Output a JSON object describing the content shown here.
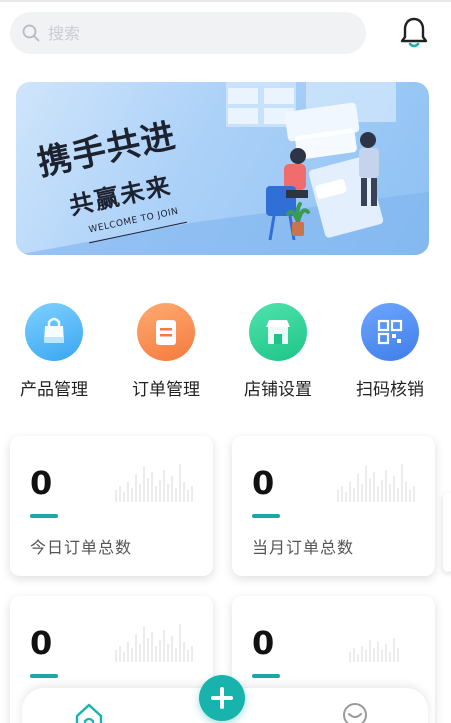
{
  "search": {
    "placeholder": "搜索",
    "icon": "search-icon"
  },
  "header": {
    "bell_icon": "bell-icon"
  },
  "banner": {
    "title": "携手共进",
    "subtitle": "共赢未来",
    "tagline": "WELCOME TO JOIN"
  },
  "menu": [
    {
      "label": "产品管理",
      "icon": "shopping-bag-icon",
      "color": "#5bb8f5"
    },
    {
      "label": "订单管理",
      "icon": "order-list-icon",
      "color": "#f58a4b"
    },
    {
      "label": "店铺设置",
      "icon": "store-icon",
      "color": "#2fd29a"
    },
    {
      "label": "扫码核销",
      "icon": "qr-scan-icon",
      "color": "#4f8df0"
    }
  ],
  "stats": [
    {
      "value": "0",
      "label": "今日订单总数"
    },
    {
      "value": "0",
      "label": "当月订单总数"
    },
    {
      "value": "0",
      "label": ""
    },
    {
      "value": "0",
      "label": ""
    }
  ],
  "tabbar": {
    "home_icon": "home-icon",
    "add_icon": "plus-icon",
    "profile_icon": "profile-icon"
  },
  "colors": {
    "accent": "#19b3ad",
    "card_bar": "#1aa7a7"
  }
}
